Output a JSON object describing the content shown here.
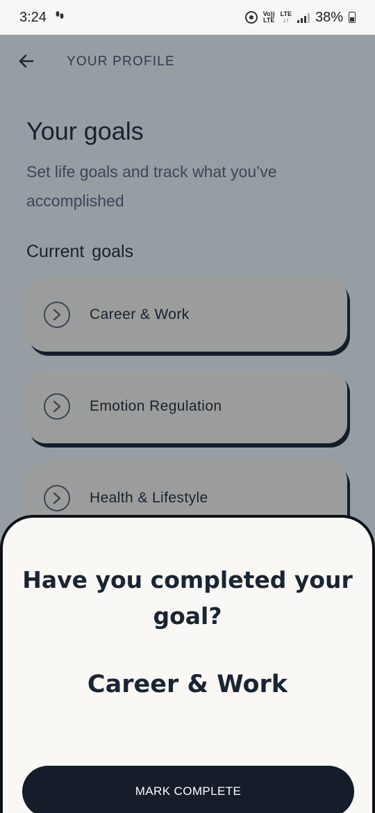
{
  "status_bar": {
    "time": "3:24",
    "network_top": "Vo))",
    "network_bottom": "LTE",
    "lte_top": "LTE",
    "lte_bottom": "↓↑",
    "battery": "38%"
  },
  "header": {
    "title": "YOUR PROFILE",
    "back_icon": "arrow-left-icon"
  },
  "page": {
    "title": "Your goals",
    "description": "Set life goals and track what you’ve accomplished",
    "current_goals_label": "Current  goals"
  },
  "goals": [
    {
      "label": "Career & Work",
      "icon": "chevron-right-circle-icon"
    },
    {
      "label": "Emotion Regulation",
      "icon": "chevron-right-circle-icon"
    },
    {
      "label": "Health & Lifestyle",
      "icon": "chevron-right-circle-icon"
    }
  ],
  "sheet": {
    "question": "Have you completed your goal?",
    "goal_name": "Career & Work",
    "button_label": "MARK COMPLETE"
  },
  "colors": {
    "overlay": "#969ea3",
    "card": "#9b9d9c",
    "card_shadow": "#141d29",
    "sheet_bg": "#faf8f5",
    "button_bg": "#141d29",
    "text_dark": "#1a2533"
  }
}
